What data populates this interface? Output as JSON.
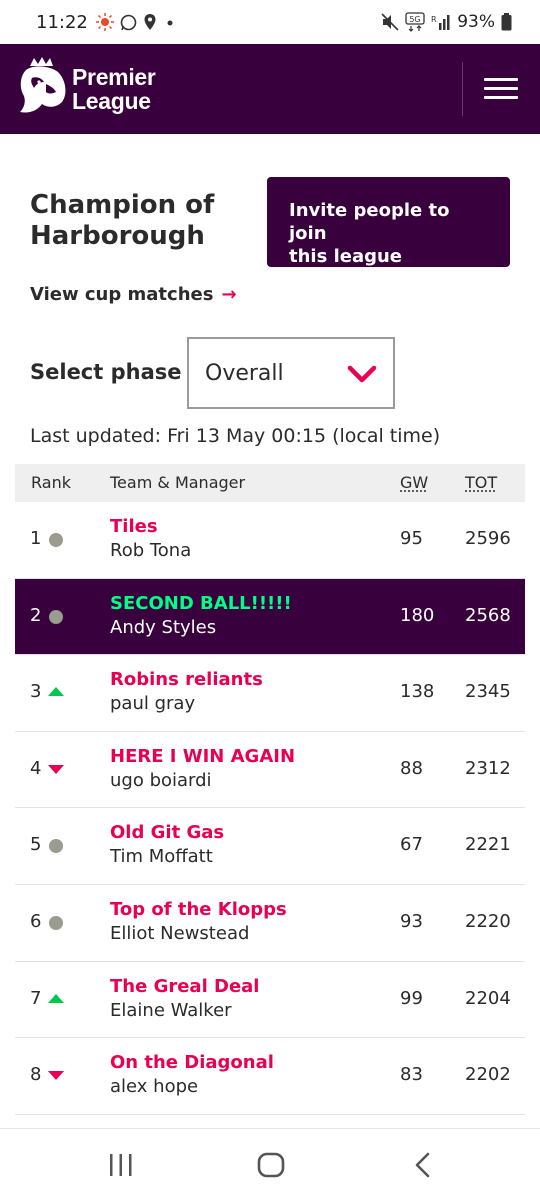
{
  "status_bar": {
    "time": "11:22",
    "battery": "93%",
    "network_label": "5G"
  },
  "header": {
    "brand_line1": "Premier",
    "brand_line2": "League",
    "colors": {
      "primary": "#38003c",
      "accent": "#e90052",
      "highlight": "#00ff85"
    }
  },
  "league": {
    "title_line1": "Champion of",
    "title_line2": "Harborough",
    "invite_label_line1": "Invite people to join",
    "invite_label_line2": "this league",
    "cup_link": "View cup matches",
    "cup_arrow": "→"
  },
  "phase": {
    "label": "Select phase",
    "selected": "Overall"
  },
  "last_updated": "Last updated: Fri 13 May 00:15 (local time)",
  "table": {
    "headers": {
      "rank": "Rank",
      "team": "Team & Manager",
      "gw": "GW",
      "tot": "TOT"
    },
    "rows": [
      {
        "rank": "1",
        "movement": "same",
        "team": "Tiles",
        "manager": "Rob Tona",
        "gw": "95",
        "tot": "2596"
      },
      {
        "rank": "2",
        "movement": "same",
        "team": "SECOND BALL!!!!!",
        "manager": "Andy Styles",
        "gw": "180",
        "tot": "2568",
        "highlighted": true
      },
      {
        "rank": "3",
        "movement": "up",
        "team": "Robins reliants",
        "manager": "paul gray",
        "gw": "138",
        "tot": "2345"
      },
      {
        "rank": "4",
        "movement": "down",
        "team": "HERE I WIN AGAIN",
        "manager": "ugo boiardi",
        "gw": "88",
        "tot": "2312"
      },
      {
        "rank": "5",
        "movement": "same",
        "team": "Old Git Gas",
        "manager": "Tim Moffatt",
        "gw": "67",
        "tot": "2221"
      },
      {
        "rank": "6",
        "movement": "same",
        "team": "Top of the Klopps",
        "manager": "Elliot Newstead",
        "gw": "93",
        "tot": "2220"
      },
      {
        "rank": "7",
        "movement": "up",
        "team": "The Greal Deal",
        "manager": "Elaine Walker",
        "gw": "99",
        "tot": "2204"
      },
      {
        "rank": "8",
        "movement": "down",
        "team": "On the Diagonal",
        "manager": "alex hope",
        "gw": "83",
        "tot": "2202"
      }
    ]
  },
  "nav_bar": {
    "icons": [
      "recent-apps-icon",
      "home-icon",
      "back-icon"
    ]
  }
}
